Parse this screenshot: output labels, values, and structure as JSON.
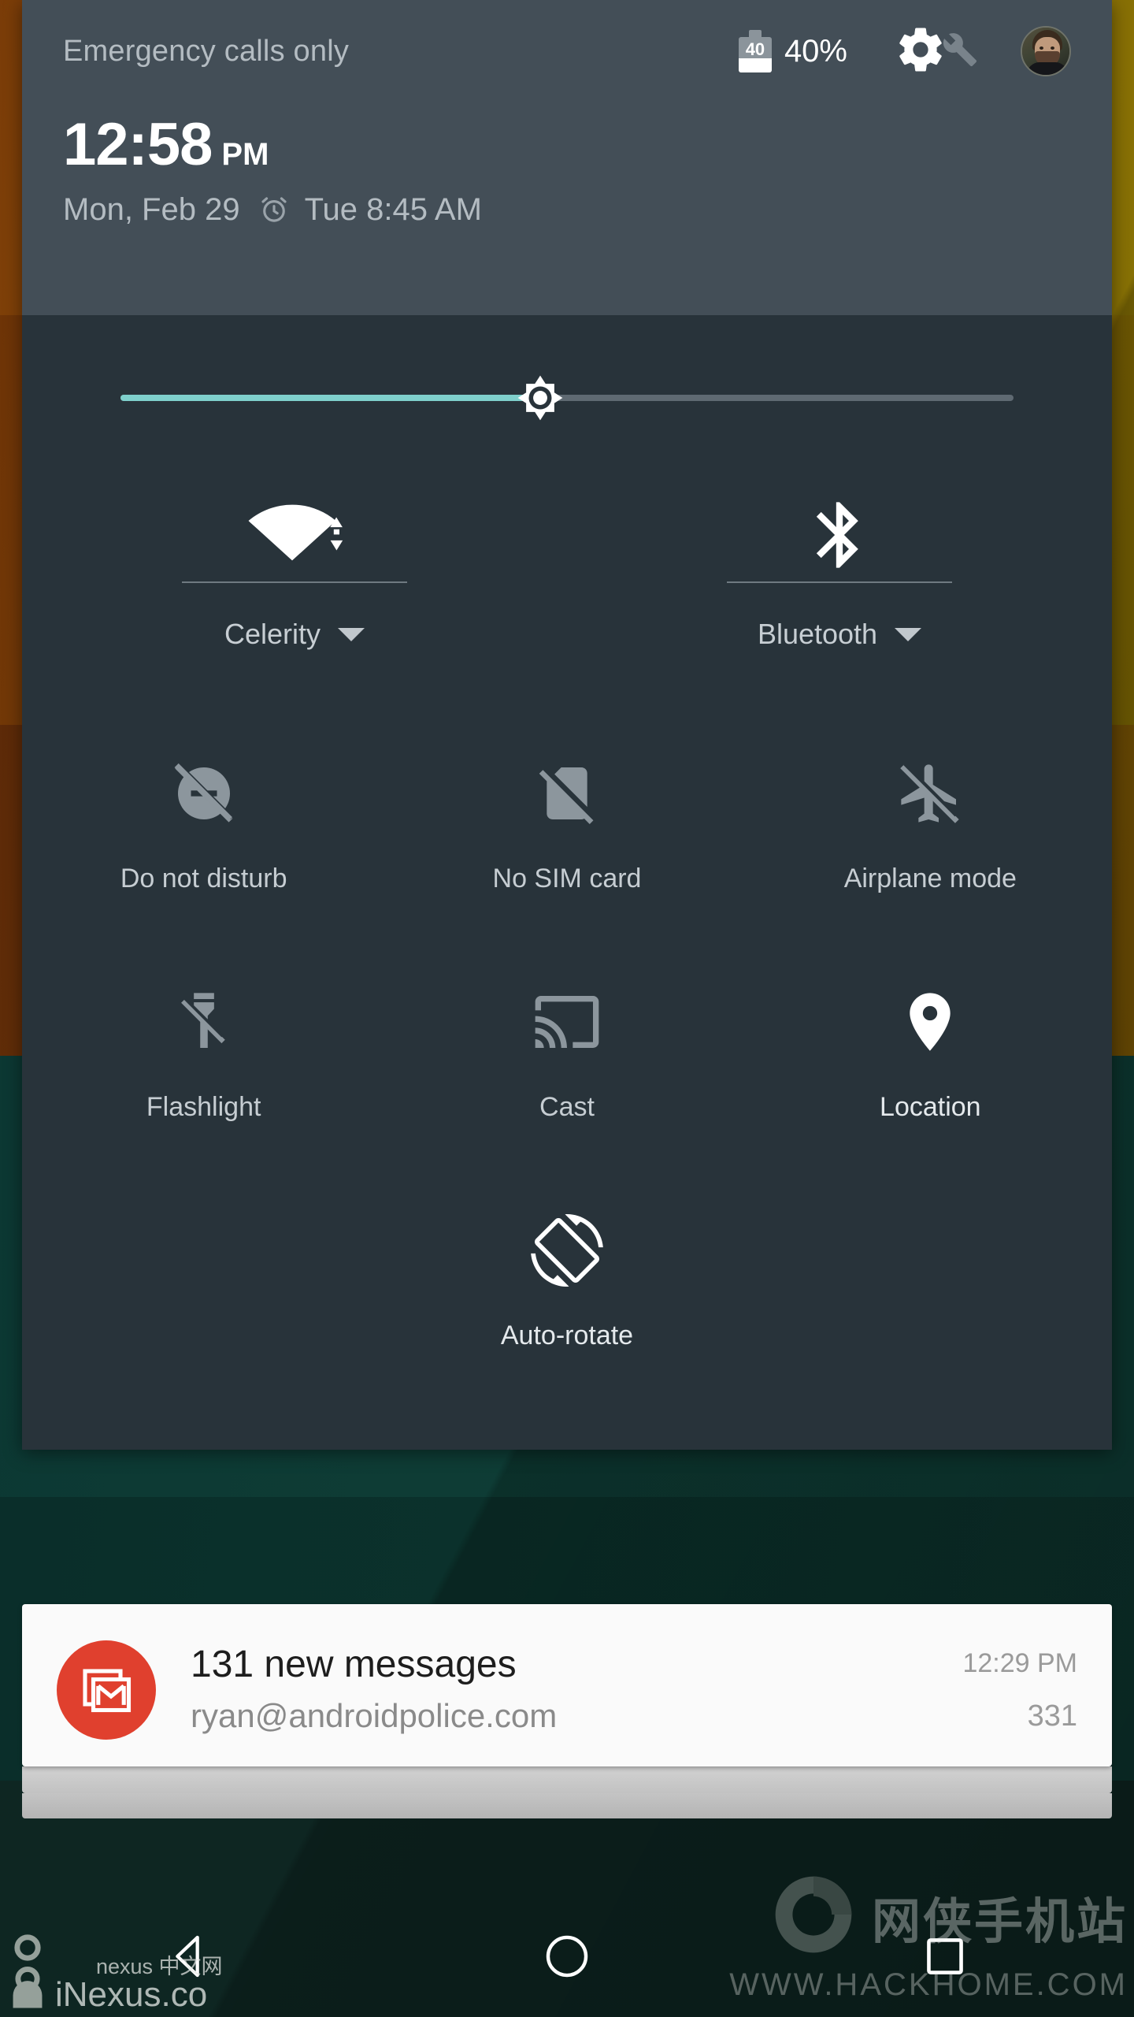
{
  "wallpaper": {
    "top_color": "#8a4a08",
    "bottom_color": "#0e3c35"
  },
  "status_bar": {
    "carrier": "Emergency calls only",
    "battery_level_text": "40",
    "battery_percent": "40%",
    "settings_icon": "gear-icon",
    "build_icon": "wrench-icon",
    "avatar_icon": "user-avatar"
  },
  "clock": {
    "time": "12:58",
    "ampm": "PM",
    "date": "Mon, Feb 29",
    "alarm_icon": "alarm-clock-icon",
    "alarm_time": "Tue 8:45 AM"
  },
  "brightness": {
    "icon": "brightness-icon",
    "value_percent": 47,
    "fill_color": "#7fd0cc",
    "track_color": "#5f6a72"
  },
  "dual_tiles": [
    {
      "label": "Celerity",
      "icon": "wifi-icon",
      "state": "on",
      "has_caret": true
    },
    {
      "label": "Bluetooth",
      "icon": "bluetooth-icon",
      "state": "on",
      "has_caret": true
    }
  ],
  "tiles": [
    {
      "label": "Do not disturb",
      "icon": "do-not-disturb-icon",
      "state": "off"
    },
    {
      "label": "No SIM card",
      "icon": "no-sim-card-icon",
      "state": "off"
    },
    {
      "label": "Airplane mode",
      "icon": "airplane-mode-icon",
      "state": "off"
    },
    {
      "label": "Flashlight",
      "icon": "flashlight-off-icon",
      "state": "off"
    },
    {
      "label": "Cast",
      "icon": "cast-icon",
      "state": "off"
    },
    {
      "label": "Location",
      "icon": "location-pin-icon",
      "state": "on"
    },
    {
      "label": "Auto-rotate",
      "icon": "auto-rotate-icon",
      "state": "on"
    }
  ],
  "notification": {
    "app_icon": "gmail-icon",
    "title": "131 new messages",
    "subtitle": "ryan@androidpolice.com",
    "time": "12:29 PM",
    "count": "331",
    "icon_color": "#e0402e"
  },
  "navbar": {
    "back": "back-triangle-icon",
    "home": "home-circle-icon",
    "recents": "recents-square-icon"
  },
  "watermarks": {
    "left_top": "nexus 中文网",
    "left_main": "iNexus.co",
    "right_cn": "网侠手机站",
    "right_url": "WWW.HACKHOME.COM"
  }
}
